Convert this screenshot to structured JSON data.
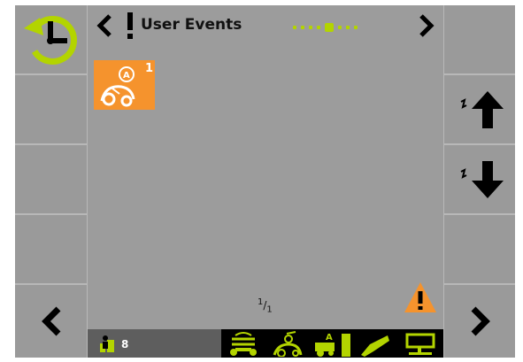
{
  "header": {
    "title": "User Events",
    "page_dots": 7,
    "active_dot": 4
  },
  "events": [
    {
      "type": "A",
      "count": "1"
    }
  ],
  "pager": {
    "current": "1",
    "total": "1"
  },
  "footer": {
    "count": "8",
    "tabs": [
      {
        "icon": "autopilot-transfer-icon"
      },
      {
        "icon": "crop-sensor-icon"
      },
      {
        "icon": "auto-fill-icon"
      },
      {
        "icon": "chute-icon"
      },
      {
        "icon": "display-icon"
      }
    ]
  },
  "colors": {
    "accent_green": "#b3d400",
    "event_orange": "#f5932d",
    "background_gray": "#9d9d9d"
  }
}
